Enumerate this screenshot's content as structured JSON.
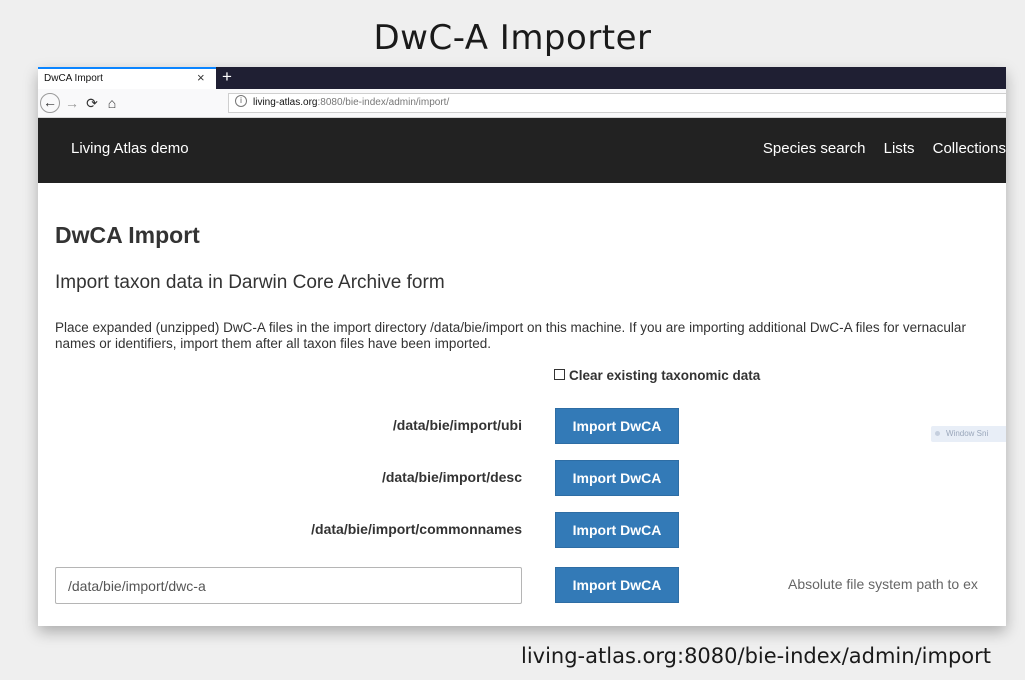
{
  "slide": {
    "title": "DwC-A Importer",
    "caption": "living-atlas.org:8080/bie-index/admin/import"
  },
  "browser": {
    "tab_title": "DwCA Import",
    "tab_close": "×",
    "new_tab": "+",
    "back_icon": "arrow-left",
    "forward_icon": "arrow-right",
    "reload_icon": "reload",
    "home_icon": "home",
    "url_host": "living-atlas.org",
    "url_rest": ":8080/bie-index/admin/import/"
  },
  "site": {
    "brand": "Living Atlas demo",
    "nav": [
      "Species search",
      "Lists",
      "Collections"
    ]
  },
  "page": {
    "title": "DwCA Import",
    "subtitle": "Import taxon data in Darwin Core Archive form",
    "instructions": "Place expanded (unzipped) DwC-A files in the import directory /data/bie/import on this machine. If you are importing additional DwC-A files for vernacular names or identifiers, import them after all taxon files have been imported.",
    "clear_label": "Clear existing taxonomic data",
    "clear_checked": false,
    "imports": [
      {
        "path": "/data/bie/import/ubi",
        "button": "Import DwCA"
      },
      {
        "path": "/data/bie/import/desc",
        "button": "Import DwCA"
      },
      {
        "path": "/data/bie/import/commonnames",
        "button": "Import DwCA"
      }
    ],
    "custom": {
      "value": "/data/bie/import/dwc-a",
      "button": "Import DwCA",
      "help": "Absolute file system path to ex"
    },
    "overlay_badge": "Window Sni"
  },
  "colors": {
    "primary": "#337ab7",
    "header_bg": "#222222",
    "tabbar_bg": "#1f1f33"
  }
}
